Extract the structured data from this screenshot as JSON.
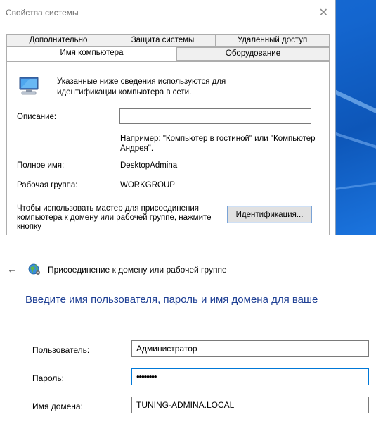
{
  "system_properties": {
    "title": "Свойства системы",
    "close_glyph": "✕",
    "tabs_row1": [
      "Дополнительно",
      "Защита системы",
      "Удаленный доступ"
    ],
    "tabs_row2": [
      "Имя компьютера",
      "Оборудование"
    ],
    "intro_text": "Указанные ниже сведения используются для идентификации компьютера в сети.",
    "description_label": "Описание:",
    "description_value": "",
    "hint_text": "Например: \"Компьютер в гостиной\" или \"Компьютер Андрея\".",
    "full_name_label": "Полное имя:",
    "full_name_value": "DesktopAdmina",
    "workgroup_label": "Рабочая группа:",
    "workgroup_value": "WORKGROUP",
    "wizard_text": "Чтобы использовать мастер для присоединения компьютера к домену или рабочей группе, нажмите кнопку",
    "identify_button": "Идентификация..."
  },
  "domain_join": {
    "back_glyph": "←",
    "title": "Присоединение к домену или рабочей группе",
    "heading": "Введите имя пользователя, пароль и имя домена для ваше",
    "user_label": "Пользователь:",
    "user_value": "Администратор",
    "password_label": "Пароль:",
    "password_value": "••••••••",
    "domain_label": "Имя домена:",
    "domain_value": "TUNING-ADMINA.LOCAL"
  },
  "icons": {
    "computer": "computer-icon",
    "globe": "globe-icon",
    "close": "close-icon",
    "back": "back-arrow-icon"
  }
}
